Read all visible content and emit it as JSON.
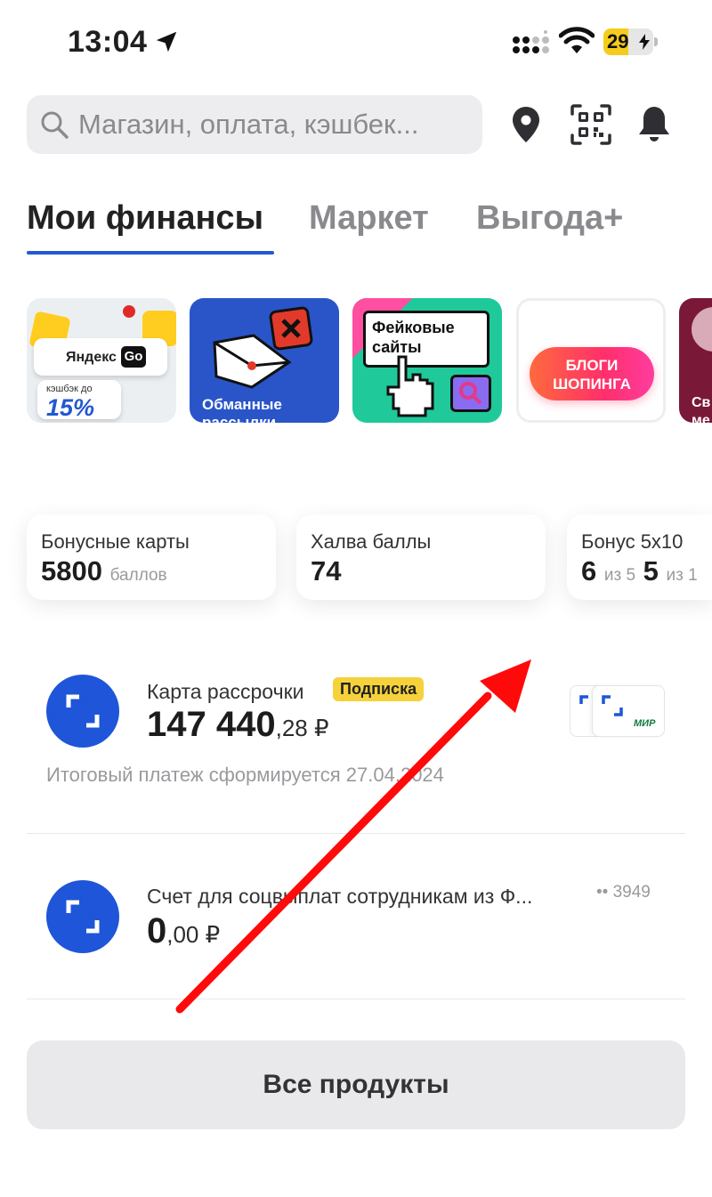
{
  "status": {
    "time": "13:04",
    "battery": "29"
  },
  "search": {
    "placeholder": "Магазин, оплата, кэшбек..."
  },
  "header_icons": [
    "location-pin-icon",
    "qr-code-icon",
    "bell-icon"
  ],
  "tabs": [
    {
      "label": "Мои финансы",
      "active": true
    },
    {
      "label": "Маркет",
      "active": false
    },
    {
      "label": "Выгода+",
      "active": false
    }
  ],
  "stories": [
    {
      "brand": "Яндекс",
      "brand_go": "Go",
      "cashback_label": "кэшбэк до",
      "cashback_value": "15%"
    },
    {
      "label": "Обманные рассылки"
    },
    {
      "label": "Фейковые сайты"
    },
    {
      "label": "БЛОГИ ШОПИНГА"
    },
    {
      "label": "Св ме"
    }
  ],
  "bonuses": [
    {
      "title": "Бонусные карты",
      "value": "5800",
      "unit": "баллов"
    },
    {
      "title": "Халва баллы",
      "value": "74"
    },
    {
      "title": "Бонус 5х10",
      "value1": "6",
      "unit1": "из 5",
      "value2": "5",
      "unit2": "из 1"
    }
  ],
  "accounts": [
    {
      "title": "Карта рассрочки",
      "badge": "Подписка",
      "amount_int": "147 440",
      "amount_frac": ",28 ₽",
      "note": "Итоговый платеж сформируется 27.04.2024",
      "card_brand": "МИР"
    },
    {
      "title": "Счет для соцвыплат сотрудникам из Ф...",
      "masked": "•• 3949",
      "amount_int": "0",
      "amount_frac": ",00 ₽"
    }
  ],
  "all_products": "Все продукты",
  "colors": {
    "brand_blue": "#1e55d9",
    "badge_yellow": "#f5d23b",
    "arrow_red": "#ff0a0a"
  }
}
